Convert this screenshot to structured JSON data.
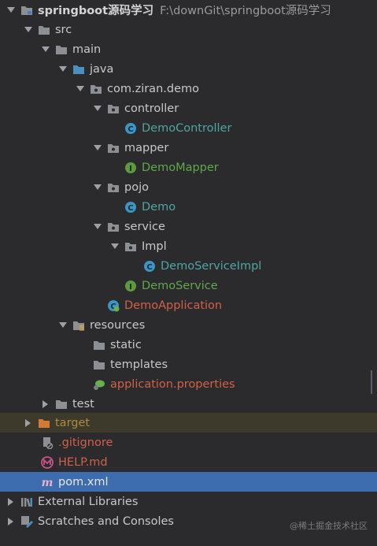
{
  "project": {
    "name": "springboot源码学习",
    "path": "F:\\downGit\\springboot源码学习"
  },
  "tree": [
    {
      "label": "src"
    },
    {
      "label": "main"
    },
    {
      "label": "java"
    },
    {
      "label": "com.ziran.demo"
    },
    {
      "label": "controller"
    },
    {
      "label": "DemoController"
    },
    {
      "label": "mapper"
    },
    {
      "label": "DemoMapper"
    },
    {
      "label": "pojo"
    },
    {
      "label": "Demo"
    },
    {
      "label": "service"
    },
    {
      "label": "Impl"
    },
    {
      "label": "DemoServiceImpl"
    },
    {
      "label": "DemoService"
    },
    {
      "label": "DemoApplication"
    },
    {
      "label": "resources"
    },
    {
      "label": "static"
    },
    {
      "label": "templates"
    },
    {
      "label": "application.properties"
    },
    {
      "label": "test"
    },
    {
      "label": "target"
    },
    {
      "label": ".gitignore"
    },
    {
      "label": "HELP.md"
    },
    {
      "label": "pom.xml"
    },
    {
      "label": "External Libraries"
    },
    {
      "label": "Scratches and Consoles"
    }
  ],
  "watermark": "@稀土掘金技术社区",
  "colors": {
    "background": "#2b2b2d",
    "selected": "#3d6dae",
    "excluded": "#3d3a2c",
    "class_icon": "#3b95c5",
    "interface_icon": "#5e9a3c",
    "folder": "#8c8f94",
    "target_folder": "#d57a36"
  }
}
